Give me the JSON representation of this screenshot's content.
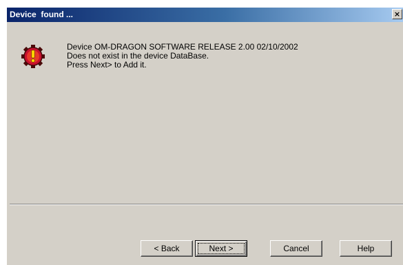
{
  "window": {
    "title": "Device  found ...",
    "close_glyph": "×"
  },
  "icon": "warning-gear-icon",
  "message": {
    "line1": "Device OM-DRAGON SOFTWARE RELEASE 2.00 02/10/2002",
    "line2": "Does not exist in the device DataBase.",
    "line3": "Press Next> to Add it."
  },
  "buttons": {
    "back": "< Back",
    "next": "Next >",
    "cancel": "Cancel",
    "help": "Help"
  },
  "colors": {
    "titlebar_start": "#0a246a",
    "titlebar_end": "#a6caf0",
    "face": "#d4d0c8",
    "icon_red": "#c8102e"
  }
}
